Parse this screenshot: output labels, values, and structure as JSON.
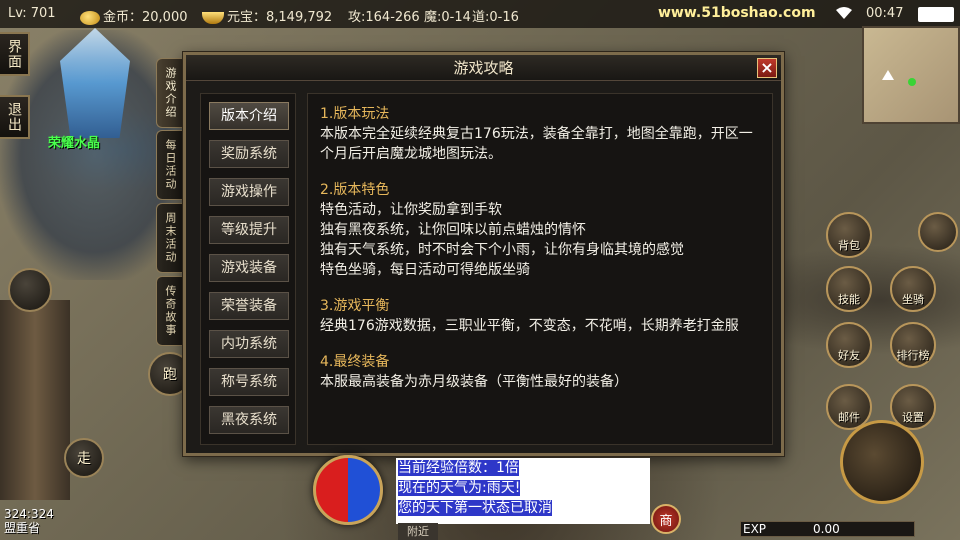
{
  "topbar": {
    "level": "Lv: 701",
    "gold": "金币：20,000",
    "yuanbao": "元宝：8,149,792",
    "attack": "攻:164-266",
    "magic": "魔:0-14",
    "tao": "道:0-16",
    "site": "www.51boshao.com",
    "time": "00:47"
  },
  "left": {
    "interface_btn": "界面",
    "exit_btn": "退出",
    "crystal_name": "荣耀水晶",
    "run_btn": "跑",
    "walk_btn": "走",
    "coords": "324:324",
    "location": "盟重省"
  },
  "side_tabs": [
    "游戏介绍",
    "每日活动",
    "周末活动",
    "传奇故事"
  ],
  "dialog": {
    "title": "游戏攻略",
    "close": "×",
    "menu": [
      "版本介绍",
      "奖励系统",
      "游戏操作",
      "等级提升",
      "游戏装备",
      "荣誉装备",
      "内功系统",
      "称号系统",
      "黑夜系统"
    ],
    "sections": [
      {
        "title": "1.版本玩法",
        "lines": [
          "本版本完全延续经典复古176玩法，装备全靠打，地图全靠跑，开区一个月后开启魔龙城地图玩法。"
        ]
      },
      {
        "title": "2.版本特色",
        "lines": [
          "特色活动，让你奖励拿到手软",
          "独有黑夜系统，让你回味以前点蜡烛的情怀",
          "独有天气系统，时不时会下个小雨，让你有身临其境的感觉",
          "特色坐骑，每日活动可得绝版坐骑"
        ]
      },
      {
        "title": "3.游戏平衡",
        "lines": [
          "经典176游戏数据，三职业平衡，不变态，不花哨，长期养老打金服"
        ]
      },
      {
        "title": "4.最终装备",
        "lines": [
          "本服最高装备为赤月级装备（平衡性最好的装备）"
        ]
      }
    ]
  },
  "right": {
    "skills": [
      "背包",
      "技能",
      "好友",
      "排行榜",
      "邮件",
      "设置"
    ],
    "mount": "坐骑"
  },
  "bottom": {
    "chat": [
      "当前经验倍数：1倍",
      "现在的天气为:雨天!",
      "您的天下第一状态已取消"
    ],
    "chat_tab": "附近",
    "shop": "商",
    "exp_label": "EXP",
    "exp_value": "0.00"
  }
}
